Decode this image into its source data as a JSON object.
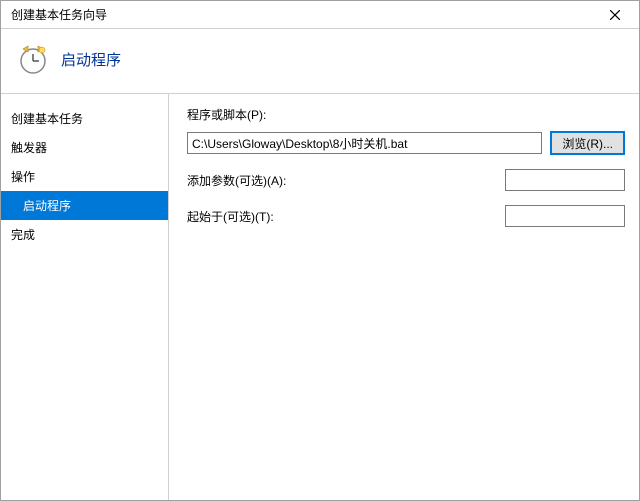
{
  "window": {
    "title": "创建基本任务向导"
  },
  "header": {
    "title": "启动程序"
  },
  "sidebar": {
    "items": [
      {
        "label": "创建基本任务",
        "selected": false,
        "sub": false
      },
      {
        "label": "触发器",
        "selected": false,
        "sub": false
      },
      {
        "label": "操作",
        "selected": false,
        "sub": false
      },
      {
        "label": "启动程序",
        "selected": true,
        "sub": true
      },
      {
        "label": "完成",
        "selected": false,
        "sub": false
      }
    ]
  },
  "main": {
    "program_label": "程序或脚本(P):",
    "program_value": "C:\\Users\\Gloway\\Desktop\\8小时关机.bat",
    "browse_label": "浏览(R)...",
    "args_label": "添加参数(可选)(A):",
    "args_value": "",
    "startin_label": "起始于(可选)(T):",
    "startin_value": ""
  }
}
